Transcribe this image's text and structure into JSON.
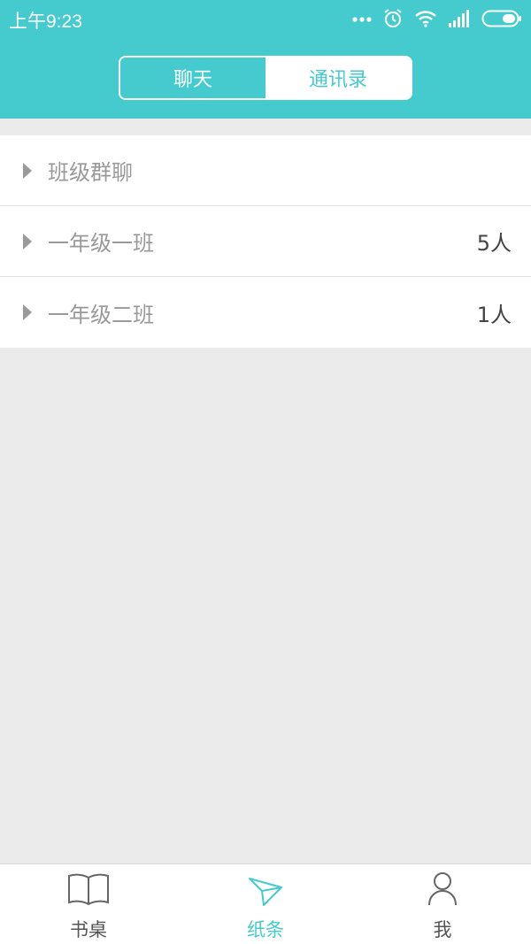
{
  "status": {
    "time": "上午9:23",
    "icons": [
      "more-dots-icon",
      "alarm-icon",
      "wifi-icon",
      "signal-icon",
      "battery-icon"
    ]
  },
  "segment": {
    "tabs": [
      {
        "label": "聊天",
        "active": true
      },
      {
        "label": "通讯录",
        "active": false
      }
    ]
  },
  "list": {
    "items": [
      {
        "label": "班级群聊",
        "count": ""
      },
      {
        "label": "一年级一班",
        "count": "5人"
      },
      {
        "label": "一年级二班",
        "count": "1人"
      }
    ]
  },
  "tabbar": {
    "items": [
      {
        "label": "书桌",
        "icon": "book-icon",
        "active": false
      },
      {
        "label": "纸条",
        "icon": "paper-plane-icon",
        "active": true
      },
      {
        "label": "我",
        "icon": "person-icon",
        "active": false
      }
    ]
  },
  "colors": {
    "accent": "#45cbcd",
    "background": "#ebebeb",
    "text_muted": "#999999",
    "text_dark": "#444444"
  }
}
